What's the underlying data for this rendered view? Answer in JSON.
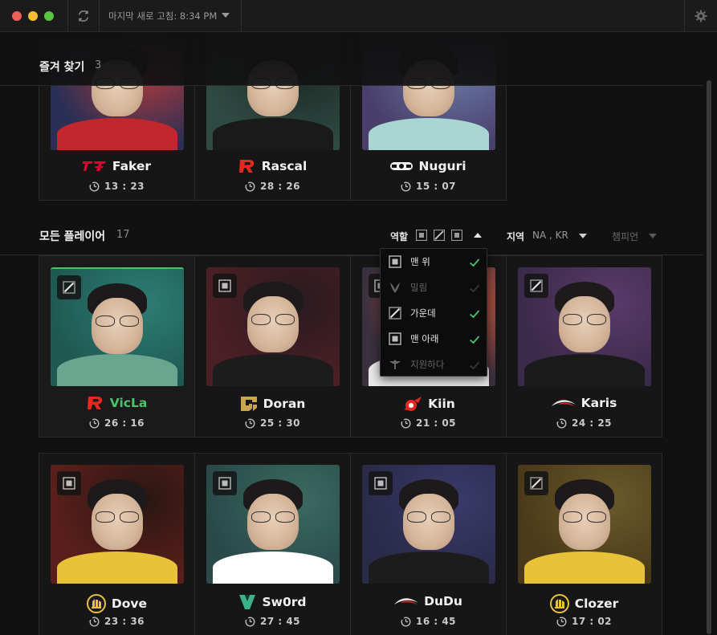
{
  "titlebar": {
    "refresh_label": "마지막 새로 고침: 8:34 PM"
  },
  "favorites": {
    "title": "즐겨 찾기",
    "count": "3",
    "players": [
      {
        "name": "Faker",
        "time": "13 : 23",
        "team_logo": "t1-logo",
        "bg": [
          "#2a2f55",
          "#b33a3a"
        ],
        "shirt": "#c1272d"
      },
      {
        "name": "Rascal",
        "time": "28 : 26",
        "team_logo": "kt-logo",
        "bg": [
          "#2f4a43",
          "#1c2a26"
        ],
        "shirt": "#1a1a1a"
      },
      {
        "name": "Nuguri",
        "time": "15 : 07",
        "team_logo": "damwon-logo",
        "bg": [
          "#4a3f6b",
          "#6b7aa8"
        ],
        "shirt": "#a9d6d3"
      }
    ]
  },
  "all_players": {
    "title": "모든 플레이어",
    "count": "17",
    "filters": {
      "role_label": "역할",
      "region_label": "지역",
      "region_value": "NA , KR",
      "champion_label": "챔피언"
    },
    "role_dropdown": [
      {
        "label": "맨 위",
        "icon": "top-lane-icon",
        "checked": true,
        "enabled": true
      },
      {
        "label": "밀림",
        "icon": "jungle-icon",
        "checked": false,
        "enabled": false
      },
      {
        "label": "가운데",
        "icon": "mid-lane-icon",
        "checked": true,
        "enabled": true
      },
      {
        "label": "맨 아래",
        "icon": "bottom-lane-icon",
        "checked": true,
        "enabled": true
      },
      {
        "label": "지원하다",
        "icon": "support-icon",
        "checked": false,
        "enabled": false
      }
    ],
    "row1": [
      {
        "name": "VicLa",
        "time": "26 : 16",
        "role": "mid",
        "team_logo": "kt-logo",
        "highlight": true,
        "bg": [
          "#1f5a52",
          "#2d7d74"
        ],
        "shirt": "#6aa58f"
      },
      {
        "name": "Doran",
        "time": "25 : 30",
        "role": "top",
        "team_logo": "gen-g-logo",
        "highlight": false,
        "bg": [
          "#4a1f25",
          "#2a1a20"
        ],
        "shirt": "#1c1c1c"
      },
      {
        "name": "Kiin",
        "time": "21 : 05",
        "role": "top",
        "team_logo": "afreeca-logo",
        "highlight": false,
        "bg": [
          "#3a3040",
          "#d9583a"
        ],
        "shirt": "#e8e8e8"
      },
      {
        "name": "Karis",
        "time": "24 : 25",
        "role": "mid",
        "team_logo": "drx-logo",
        "highlight": false,
        "bg": [
          "#3b2a4a",
          "#5b3a6b"
        ],
        "shirt": "#1a1a1a"
      }
    ],
    "row2": [
      {
        "name": "Dove",
        "time": "23 : 36",
        "role": "top",
        "team_logo": "hanwha-logo",
        "highlight": false,
        "bg": [
          "#5a1f1a",
          "#2a1612"
        ],
        "shirt": "#e8c339"
      },
      {
        "name": "Sw0rd",
        "time": "27 : 45",
        "role": "top",
        "team_logo": "brion-logo",
        "highlight": false,
        "bg": [
          "#2a4a4a",
          "#3b6a60"
        ],
        "shirt": "#ffffff"
      },
      {
        "name": "DuDu",
        "time": "16 : 45",
        "role": "top",
        "team_logo": "drx-logo",
        "highlight": false,
        "bg": [
          "#2a2a4a",
          "#3a3a6a"
        ],
        "shirt": "#1c1c1c"
      },
      {
        "name": "Clozer",
        "time": "17 : 02",
        "role": "mid",
        "team_logo": "hanwha-logo",
        "highlight": false,
        "bg": [
          "#4a3a1a",
          "#6a5a2a"
        ],
        "shirt": "#e8c339"
      }
    ]
  }
}
